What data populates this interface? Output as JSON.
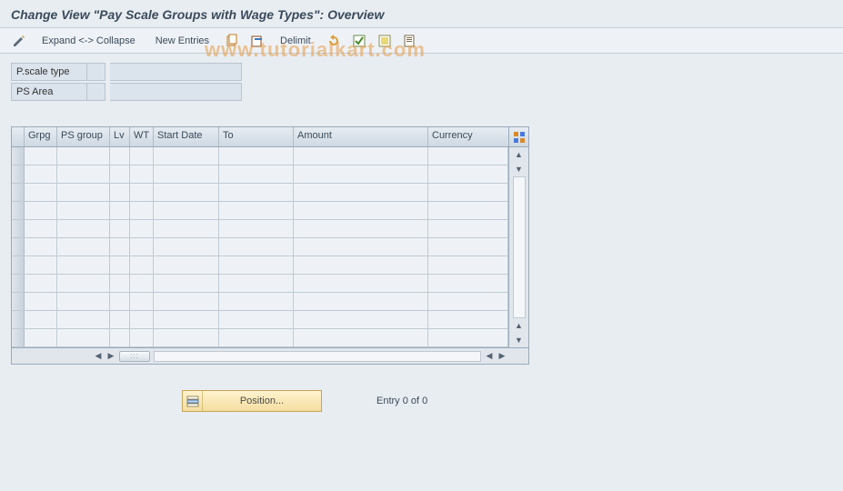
{
  "title": "Change View \"Pay Scale Groups with Wage Types\": Overview",
  "toolbar": {
    "expand_collapse": "Expand <-> Collapse",
    "new_entries": "New Entries",
    "delimit": "Delimit"
  },
  "filters": {
    "pscale_type": {
      "label": "P.scale type",
      "code": "",
      "desc": ""
    },
    "ps_area": {
      "label": "PS Area",
      "code": "",
      "desc": ""
    }
  },
  "table": {
    "columns": {
      "grpg": "Grpg",
      "ps_group": "PS group",
      "lv": "Lv",
      "wt": "WT",
      "start_date": "Start Date",
      "to": "To",
      "amount": "Amount",
      "currency": "Currency"
    },
    "rows": []
  },
  "footer": {
    "position_label": "Position...",
    "entry_status": "Entry 0 of 0"
  },
  "watermark": "www.tutorialkart.com"
}
